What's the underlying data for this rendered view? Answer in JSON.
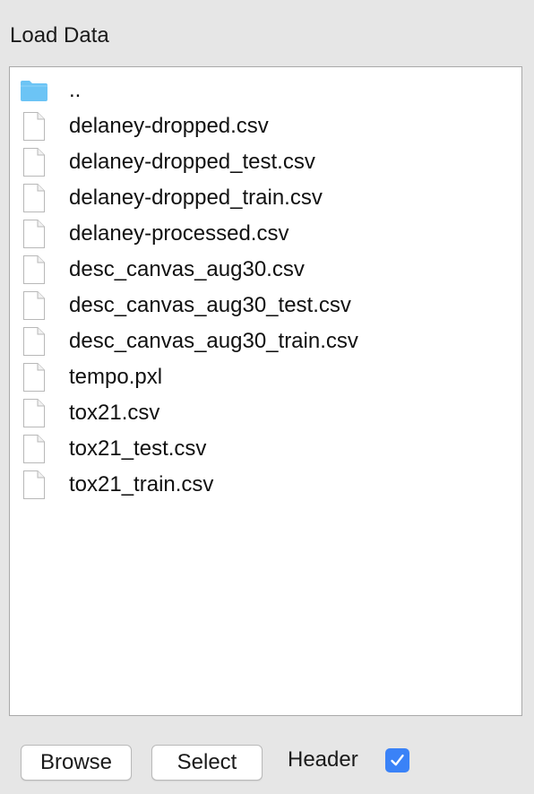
{
  "panel": {
    "title": "Load Data"
  },
  "file_list": {
    "items": [
      {
        "name": "..",
        "icon": "folder-icon"
      },
      {
        "name": "delaney-dropped.csv",
        "icon": "file-icon"
      },
      {
        "name": "delaney-dropped_test.csv",
        "icon": "file-icon"
      },
      {
        "name": "delaney-dropped_train.csv",
        "icon": "file-icon"
      },
      {
        "name": "delaney-processed.csv",
        "icon": "file-icon"
      },
      {
        "name": "desc_canvas_aug30.csv",
        "icon": "file-icon"
      },
      {
        "name": "desc_canvas_aug30_test.csv",
        "icon": "file-icon"
      },
      {
        "name": "desc_canvas_aug30_train.csv",
        "icon": "file-icon"
      },
      {
        "name": "tempo.pxl",
        "icon": "file-icon"
      },
      {
        "name": "tox21.csv",
        "icon": "file-icon"
      },
      {
        "name": "tox21_test.csv",
        "icon": "file-icon"
      },
      {
        "name": "tox21_train.csv",
        "icon": "file-icon"
      }
    ]
  },
  "footer": {
    "browse_label": "Browse",
    "select_label": "Select",
    "header_label": "Header",
    "header_checked": true
  },
  "colors": {
    "background": "#e6e6e6",
    "list_background": "#ffffff",
    "folder": "#6cc4f5",
    "checkbox_accent": "#3a82f7"
  }
}
